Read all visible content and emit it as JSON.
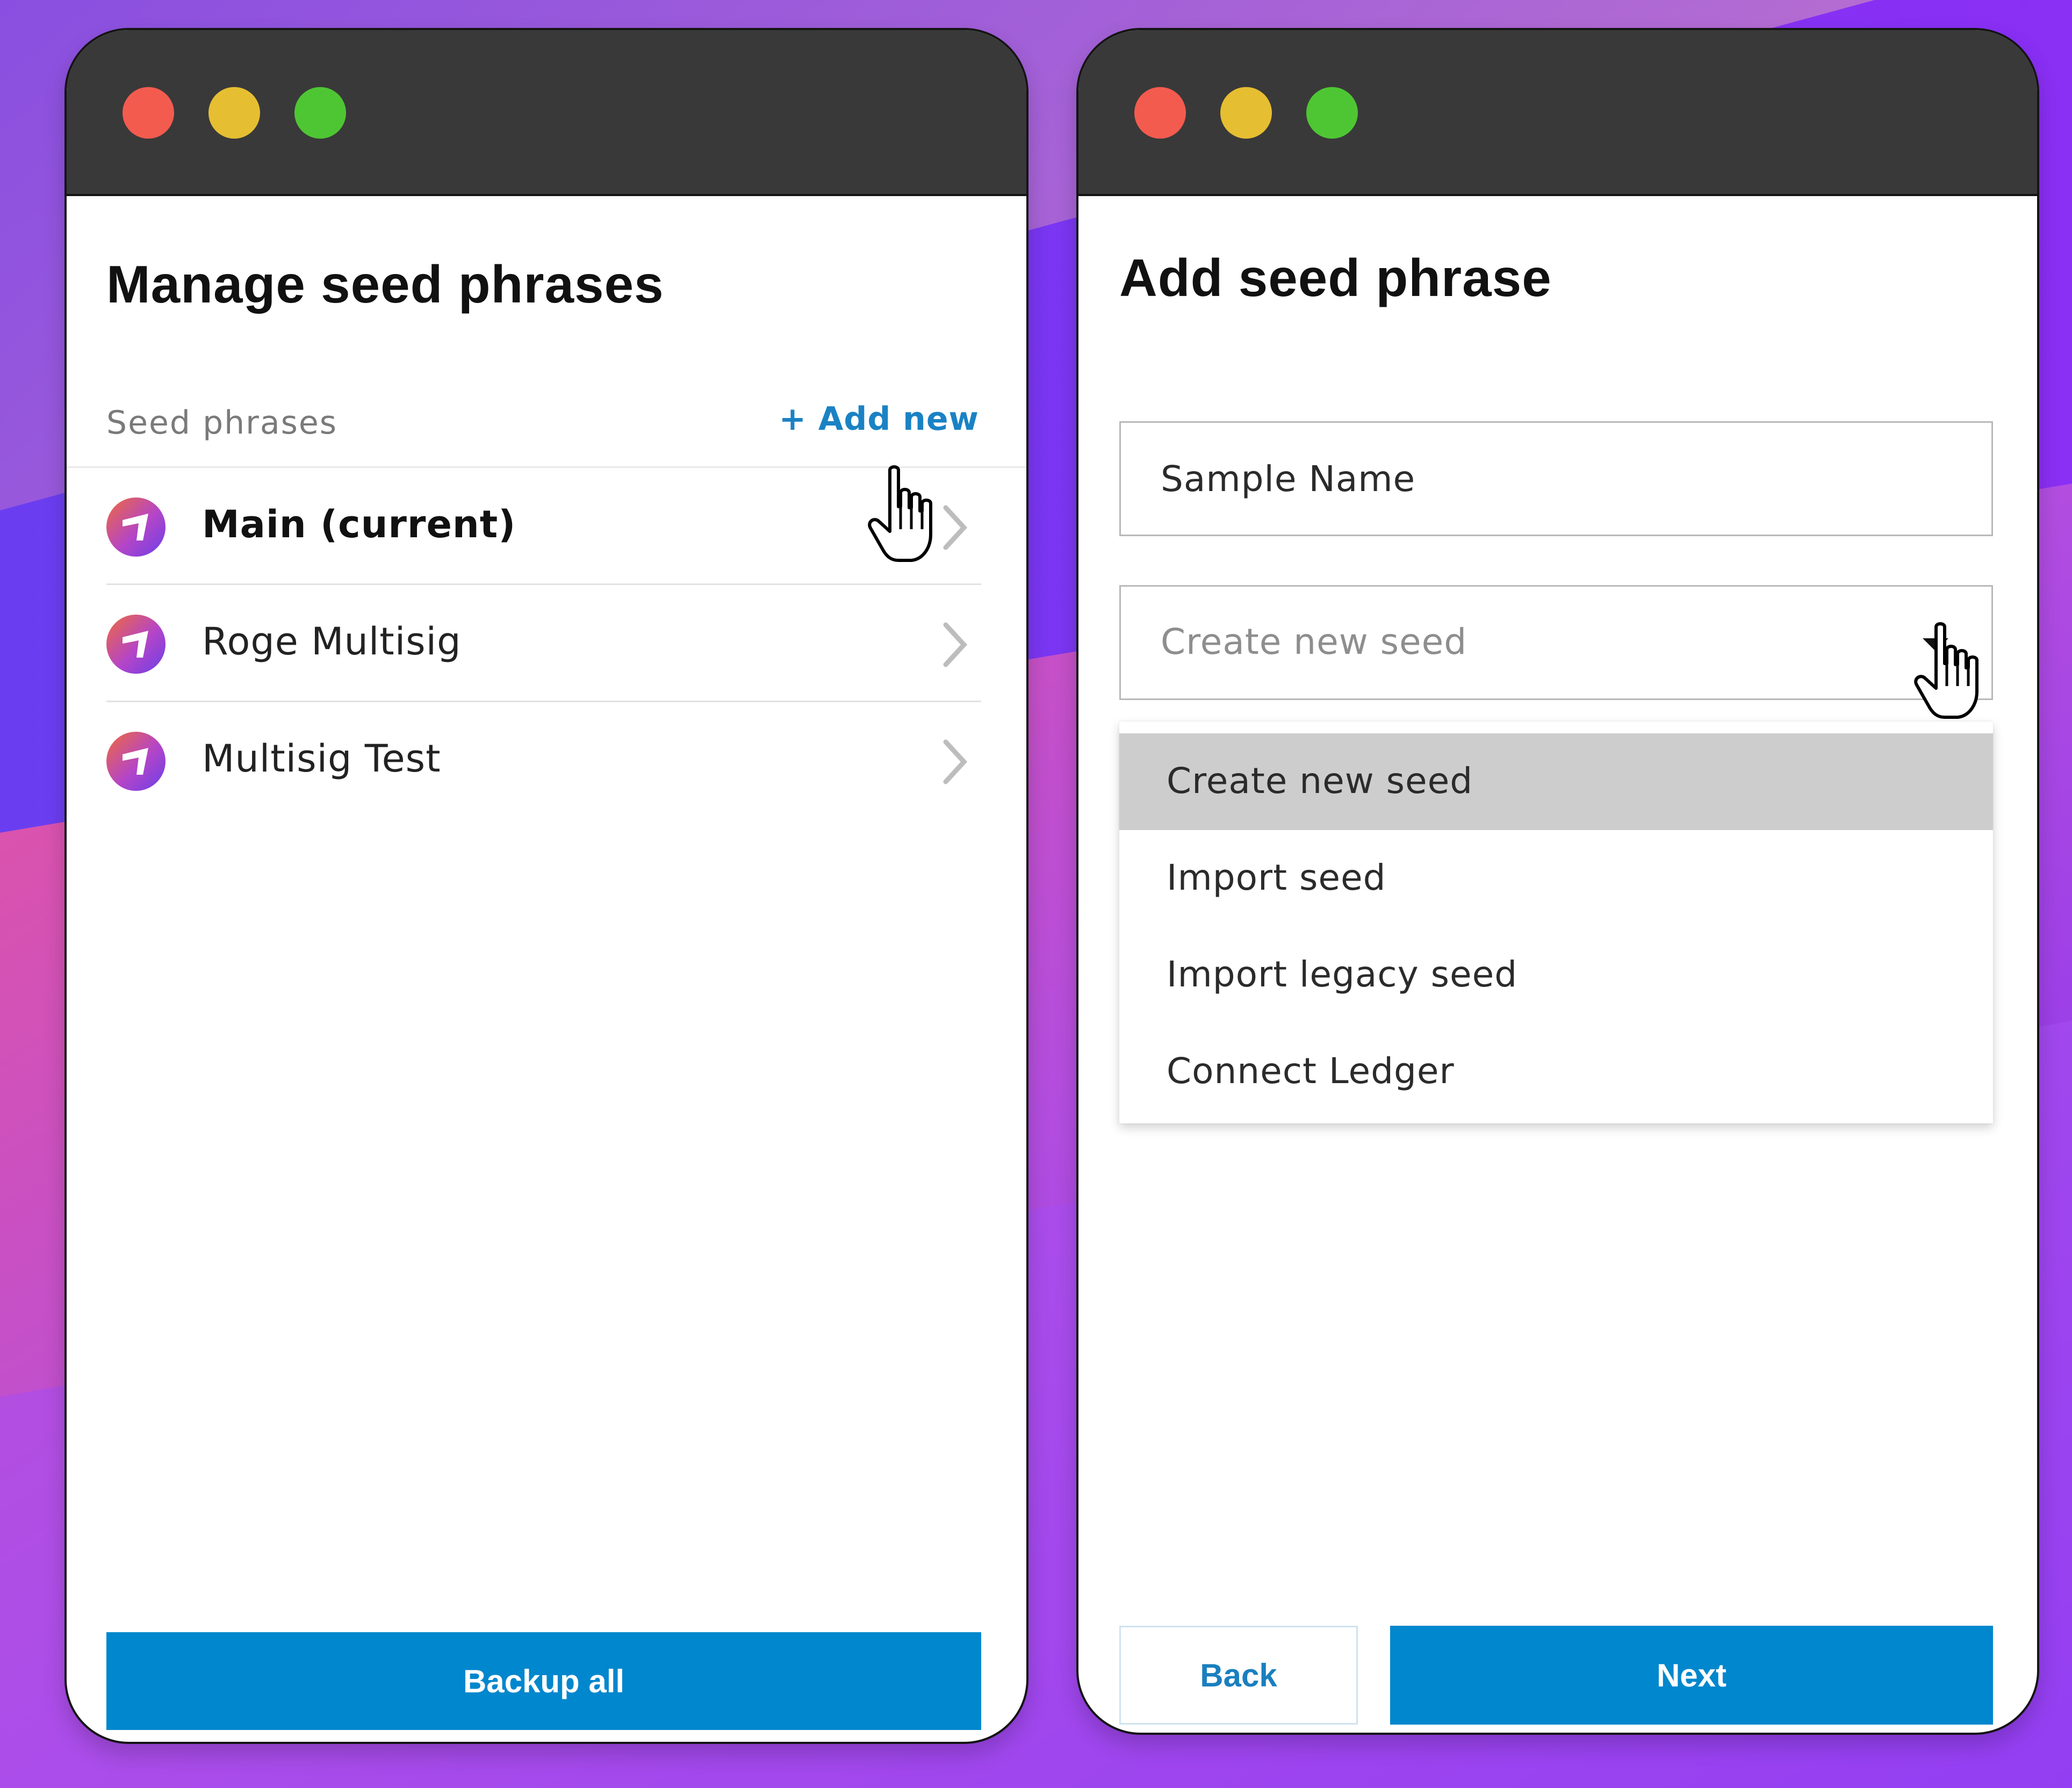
{
  "left_window": {
    "title": "Manage seed phrases",
    "section_label": "Seed phrases",
    "add_new_label": "+ Add new",
    "seeds": [
      {
        "label": "Main (current)",
        "current": true
      },
      {
        "label": "Roge Multisig",
        "current": false
      },
      {
        "label": "Multisig Test",
        "current": false
      }
    ],
    "backup_label": "Backup all"
  },
  "right_window": {
    "title": "Add seed phrase",
    "name_field": {
      "value": "Sample Name"
    },
    "type_select": {
      "value": "Create new seed",
      "options": [
        "Create new seed",
        "Import seed",
        "Import legacy seed",
        "Connect Ledger"
      ],
      "highlighted_index": 0
    },
    "back_label": "Back",
    "next_label": "Next"
  },
  "colors": {
    "accent": "#0087cd",
    "link": "#1a82c4",
    "titlebar": "#393939",
    "close": "#f45b4f",
    "minimize": "#e6be31",
    "maximize": "#4ec633"
  },
  "icons": {
    "window_controls": [
      "close-dot",
      "minimize-dot",
      "maximize-dot"
    ],
    "seed_item": "seed-logo-icon",
    "row_arrow": "chevron-right-icon",
    "select_arrow": "caret-down-icon",
    "cursor": "hand-pointer-cursor-icon"
  }
}
